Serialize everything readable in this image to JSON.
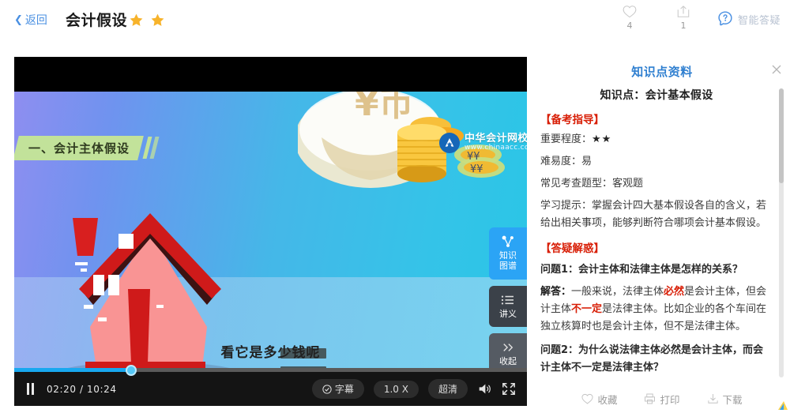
{
  "header": {
    "back_label": "返回",
    "title": "会计假设",
    "star_count": 2,
    "like": {
      "icon": "heart-icon",
      "count": "4"
    },
    "share": {
      "icon": "share-icon",
      "count": "1"
    },
    "ai_assistant": {
      "icon": "ai-question-head-icon",
      "label": "智能答疑"
    }
  },
  "video": {
    "banner_title": "一、会计主体假设",
    "subtitle": "看它是多少钱呢",
    "watermark": {
      "cn": "中华会计网校",
      "en": "www.chinaacc.com"
    },
    "side_tools": [
      {
        "icon": "knowledge-graph-icon",
        "label_line1": "知识",
        "label_line2": "图谱"
      },
      {
        "icon": "list-icon",
        "label_line1": "讲义",
        "label_line2": ""
      },
      {
        "icon": "double-chevron-right-icon",
        "label_line1": "收起",
        "label_line2": ""
      }
    ],
    "controls": {
      "play_state": "pause",
      "current_time": "02:20",
      "separator": "/",
      "duration": "10:24",
      "time_display": "02:20 / 10:24",
      "progress_percent": 22.8,
      "subtitle_btn": "字幕",
      "speed_btn": "1.0 X",
      "quality_btn": "超清",
      "volume_icon": "volume-icon",
      "fullscreen_icon": "fullscreen-icon"
    }
  },
  "panel": {
    "title": "知识点资料",
    "close_icon": "close-icon",
    "knowledge_point": "知识点：会计基本假设",
    "section1_head": "【备考指导】",
    "importance_label": "重要程度：",
    "importance_stars": "★★",
    "difficulty": "难易度：易",
    "question_type": "常见考查题型：客观题",
    "study_tip": "学习提示：掌握会计四大基本假设各自的含义，若给出相关事项，能够判断符合哪项会计基本假设。",
    "section2_head": "【答疑解惑】",
    "q1": "问题1：会计主体和法律主体是怎样的关系？",
    "a1": {
      "label": "解答：",
      "t1": "一般来说，法律主体",
      "em1": "必然",
      "t2": "是会计主体，但会计主体",
      "em2": "不一定",
      "t3": "是法律主体。比如企业的各个车间在独立核算时也是会计主体，但不是法律主体。"
    },
    "q2": "问题2：为什么说法律主体必然是会计主体，而会计主体不一定是法律主体？",
    "footer": [
      {
        "icon": "heart-icon",
        "label": "收藏"
      },
      {
        "icon": "print-icon",
        "label": "打印"
      },
      {
        "icon": "download-icon",
        "label": "下载"
      }
    ]
  },
  "colors": {
    "accent_blue": "#2f7fd0",
    "link_blue": "#4a90e2",
    "red": "#d81e06",
    "star_gold": "#f5a623",
    "player_blue": "#18a8ef",
    "tool_blue": "#2ba4f5"
  }
}
